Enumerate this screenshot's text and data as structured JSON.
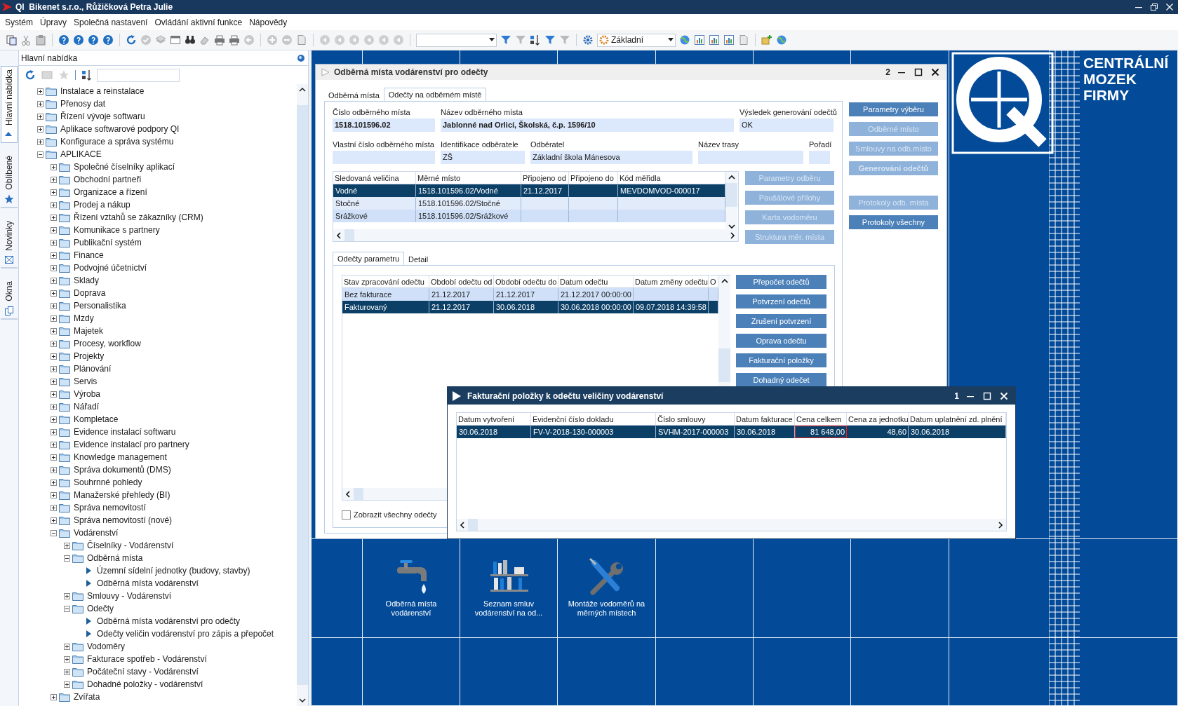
{
  "app": {
    "title": "QI  Bikenet s.r.o., Růžičková Petra Julie"
  },
  "menu": [
    "Systém",
    "Úpravy",
    "Společná nastavení",
    "Ovládání aktivní funkce",
    "Nápovědy"
  ],
  "toolbar": {
    "view_combo": "Základní"
  },
  "side_tabs": [
    {
      "label": "Hlavní nabídka",
      "selected": true
    },
    {
      "label": "Oblíbené",
      "selected": false
    },
    {
      "label": "Novinky",
      "selected": false
    },
    {
      "label": "Okna",
      "selected": false
    }
  ],
  "panel": {
    "title": "Hlavní nabídka",
    "tree": [
      {
        "label": "Instalace a reinstalace",
        "kind": "folder",
        "expanded": false
      },
      {
        "label": "Přenosy dat",
        "kind": "folder",
        "expanded": false
      },
      {
        "label": "Řízení vývoje softwaru",
        "kind": "folder",
        "expanded": false
      },
      {
        "label": "Aplikace softwarové podpory QI",
        "kind": "folder",
        "expanded": false
      },
      {
        "label": "Konfigurace a správa systému",
        "kind": "folder",
        "expanded": false
      },
      {
        "label": "APLIKACE",
        "kind": "folder",
        "expanded": true,
        "children": [
          {
            "label": "Společné číselníky aplikací",
            "kind": "folder",
            "expanded": false
          },
          {
            "label": "Obchodní partneři",
            "kind": "folder",
            "expanded": false
          },
          {
            "label": "Organizace a řízení",
            "kind": "folder",
            "expanded": false
          },
          {
            "label": "Prodej a nákup",
            "kind": "folder",
            "expanded": false
          },
          {
            "label": "Řízení vztahů se zákazníky (CRM)",
            "kind": "folder",
            "expanded": false
          },
          {
            "label": "Komunikace s partnery",
            "kind": "folder",
            "expanded": false
          },
          {
            "label": "Publikační systém",
            "kind": "folder",
            "expanded": false
          },
          {
            "label": "Finance",
            "kind": "folder",
            "expanded": false
          },
          {
            "label": "Podvojné účetnictví",
            "kind": "folder",
            "expanded": false
          },
          {
            "label": "Sklady",
            "kind": "folder",
            "expanded": false
          },
          {
            "label": "Doprava",
            "kind": "folder",
            "expanded": false
          },
          {
            "label": "Personalistika",
            "kind": "folder",
            "expanded": false
          },
          {
            "label": "Mzdy",
            "kind": "folder",
            "expanded": false
          },
          {
            "label": "Majetek",
            "kind": "folder",
            "expanded": false
          },
          {
            "label": "Procesy, workflow",
            "kind": "folder",
            "expanded": false
          },
          {
            "label": "Projekty",
            "kind": "folder",
            "expanded": false
          },
          {
            "label": "Plánování",
            "kind": "folder",
            "expanded": false
          },
          {
            "label": "Servis",
            "kind": "folder",
            "expanded": false
          },
          {
            "label": "Výroba",
            "kind": "folder",
            "expanded": false
          },
          {
            "label": "Nářadí",
            "kind": "folder",
            "expanded": false
          },
          {
            "label": "Kompletace",
            "kind": "folder",
            "expanded": false
          },
          {
            "label": "Evidence instalací softwaru",
            "kind": "folder",
            "expanded": false
          },
          {
            "label": "Evidence instalací pro partnery",
            "kind": "folder",
            "expanded": false
          },
          {
            "label": "Knowledge management",
            "kind": "folder",
            "expanded": false
          },
          {
            "label": "Správa dokumentů (DMS)",
            "kind": "folder",
            "expanded": false
          },
          {
            "label": "Souhrnné pohledy",
            "kind": "folder",
            "expanded": false
          },
          {
            "label": "Manažerské přehledy (BI)",
            "kind": "folder",
            "expanded": false
          },
          {
            "label": "Správa nemovitostí",
            "kind": "folder",
            "expanded": false
          },
          {
            "label": "Správa nemovitostí (nové)",
            "kind": "folder",
            "expanded": false
          },
          {
            "label": "Vodárenství",
            "kind": "folder",
            "expanded": true,
            "children": [
              {
                "label": "Číselníky - Vodárenství",
                "kind": "folder",
                "expanded": false
              },
              {
                "label": "Odběrná místa",
                "kind": "folder",
                "expanded": true,
                "children": [
                  {
                    "label": "Územní sídelní jednotky (budovy, stavby)",
                    "kind": "function"
                  },
                  {
                    "label": "Odběrná místa vodárenství",
                    "kind": "function"
                  }
                ]
              },
              {
                "label": "Smlouvy - Vodárenství",
                "kind": "folder",
                "expanded": false
              },
              {
                "label": "Odečty",
                "kind": "folder",
                "expanded": true,
                "children": [
                  {
                    "label": "Odběrná místa vodárenství pro odečty",
                    "kind": "function"
                  },
                  {
                    "label": "Odečty veličin vodárenství pro zápis a přepočet",
                    "kind": "function"
                  }
                ]
              },
              {
                "label": "Vodoměry",
                "kind": "folder",
                "expanded": false
              },
              {
                "label": "Fakturace spotřeb - Vodárenství",
                "kind": "folder",
                "expanded": false
              },
              {
                "label": "Počáteční stavy - Vodárenství",
                "kind": "folder",
                "expanded": false
              },
              {
                "label": "Dohadné položky - vodárenství",
                "kind": "folder",
                "expanded": false
              }
            ]
          },
          {
            "label": "Zvířata",
            "kind": "folder",
            "expanded": false
          }
        ]
      }
    ]
  },
  "main_window": {
    "title": "Odběrná místa vodárenství pro odečty",
    "count": "2",
    "tabs": [
      {
        "label": "Odběrná místa",
        "selected": false
      },
      {
        "label": "Odečty na odběrném místě",
        "selected": true
      }
    ],
    "fields": [
      [
        {
          "label": "Číslo odběrného místa",
          "value": "1518.101596.02",
          "bold": true
        },
        {
          "label": "Název odběrného místa",
          "value": "Jablonné nad Orlicí, Školská, č.p. 1596/10",
          "bold": true
        },
        {
          "label": "Výsledek generování odečtů",
          "value": "OK",
          "bold": false
        }
      ],
      [
        {
          "label": "Vlastní číslo odběrného místa"
        },
        {
          "label": "Identifikace odběratele",
          "value": "ZŠ",
          "bold": false
        },
        {
          "label": "Odběratel",
          "value": "Základní škola Mánesova",
          "bold": false
        },
        {
          "label": "Název trasy"
        },
        {
          "label": "Pořadí"
        }
      ]
    ],
    "meters": {
      "columns": [
        "Sledovaná veličina",
        "Měrné místo",
        "Připojeno od",
        "Připojeno do",
        "Kód měřidla"
      ],
      "rows": [
        {
          "cells": [
            "Vodné",
            "1518.101596.02/Vodné",
            "21.12.2017",
            null,
            "MEVDOMVOD-000017"
          ],
          "selected": true
        },
        {
          "cells": [
            "Stočné",
            "1518.101596.02/Stočné",
            null,
            null,
            null
          ],
          "selected": false
        },
        {
          "cells": [
            "Srážkové",
            "1518.101596.02/Srážkové",
            null,
            null,
            null
          ],
          "selected": false
        }
      ]
    },
    "meter_buttons": [
      {
        "label": "Parametry odběru",
        "disabled": true
      },
      {
        "label": "Paušálové přílohy",
        "disabled": true
      },
      {
        "label": "Karta vodoměru",
        "disabled": true
      },
      {
        "label": "Struktura měr. místa",
        "disabled": true
      }
    ],
    "action_groups": [
      [
        {
          "label": "Parametry výběru",
          "disabled": false,
          "bold": false
        },
        {
          "label": "Odběrné místo",
          "disabled": true,
          "bold": false
        },
        {
          "label": "Smlouvy na odb.místo",
          "disabled": true,
          "bold": false
        },
        {
          "label": "Generování odečtů",
          "disabled": true,
          "bold": true
        }
      ],
      [
        {
          "label": "Protokoly odb. místa",
          "disabled": true,
          "bold": false
        },
        {
          "label": "Protokoly všechny",
          "disabled": false,
          "bold": false
        }
      ]
    ],
    "sub_tabs": [
      {
        "label": "Odečty parametru",
        "selected": true
      },
      {
        "label": "Detail",
        "selected": false
      }
    ],
    "readings": {
      "columns": [
        "Stav zpracování odečtu",
        "Období odečtu od",
        "Období odečtu do",
        "Datum odečtu",
        "Datum změny odečtu",
        "O"
      ],
      "rows": [
        {
          "cells": [
            "Bez fakturace",
            "21.12.2017",
            "21.12.2017",
            "21.12.2017 00:00:00",
            null,
            null
          ],
          "selected": false
        },
        {
          "cells": [
            "Fakturovaný",
            "21.12.2017",
            "30.06.2018",
            "30.06.2018 00:00:00",
            "09.07.2018 14:39:58",
            null
          ],
          "selected": true
        }
      ]
    },
    "reading_buttons": [
      {
        "label": "Přepočet odečtů",
        "disabled": false
      },
      {
        "label": "Potvrzení odečtů",
        "disabled": false
      },
      {
        "label": "Zrušení potvrzení",
        "disabled": false
      },
      {
        "label": "Oprava odečtu",
        "disabled": false
      },
      {
        "label": "Fakturační položky",
        "disabled": false
      },
      {
        "label": "Dohadný odečet",
        "disabled": false
      }
    ],
    "show_all": {
      "label": "Zobrazit všechny odečty",
      "checked": false
    }
  },
  "popup": {
    "title": "Fakturační položky k odečtu veličiny vodárenství",
    "count": "1",
    "columns": [
      {
        "label": "Datum vytvoření",
        "numeric": false
      },
      {
        "label": "Evidenční číslo dokladu",
        "numeric": false
      },
      {
        "label": "Číslo smlouvy",
        "numeric": false
      },
      {
        "label": "Datum fakturace",
        "numeric": false
      },
      {
        "label": "Cena celkem",
        "numeric": true
      },
      {
        "label": "Cena za jednotku",
        "numeric": true
      },
      {
        "label": "Datum uplatnění zd. plnění",
        "numeric": false
      }
    ],
    "rows": [
      {
        "selected": true,
        "cells": [
          {
            "text": "30.06.2018",
            "focused": false
          },
          {
            "text": "FV-V-2018-130-000003",
            "focused": false
          },
          {
            "text": "SVHM-2017-000003",
            "focused": false
          },
          {
            "text": "30.06.2018",
            "focused": false
          },
          {
            "text": "81 648,00",
            "focused": true
          },
          {
            "text": "48,60",
            "focused": false
          },
          {
            "text": "30.06.2018",
            "focused": false
          }
        ]
      }
    ]
  },
  "tiles": [
    {
      "label": "Odběrná místa vodárenství",
      "kind": "tap"
    },
    {
      "label": "Seznam smluv vodárenství na od...",
      "kind": "shelf"
    },
    {
      "label": "Montáže vodoměrů na měrných místech",
      "kind": "tools"
    }
  ],
  "logo": {
    "text": "CENTRÁLNÍ MOZEK FIRMY"
  }
}
